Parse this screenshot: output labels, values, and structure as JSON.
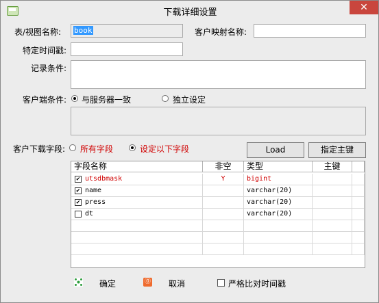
{
  "window": {
    "title": "下载详细设置",
    "close_glyph": "✕"
  },
  "form": {
    "table_view_label": "表/视图名称:",
    "table_view_value": "book",
    "client_map_label": "客户映射名称:",
    "client_map_value": "",
    "specific_time_label": "特定时间戳:",
    "specific_time_value": "",
    "record_cond_label": "记录条件:",
    "record_cond_value": "",
    "client_cond_label": "客户端条件:",
    "client_cond_options": [
      "与服务器一致",
      "独立设定"
    ],
    "client_cond_selected": "与服务器一致",
    "client_cond_value": "",
    "client_download_label": "客户下载字段:",
    "download_options": [
      "所有字段",
      "设定以下字段"
    ],
    "download_selected": "设定以下字段",
    "load_button": "Load",
    "pk_button": "指定主键"
  },
  "grid": {
    "columns": [
      "字段名称",
      "非空",
      "类型",
      "主键"
    ],
    "rows": [
      {
        "checked": true,
        "name": "utsdbmask",
        "notnull": "Y",
        "type": "bigint",
        "pk": "",
        "highlight": true
      },
      {
        "checked": true,
        "name": "name",
        "notnull": "",
        "type": "varchar(20)",
        "pk": "",
        "highlight": false
      },
      {
        "checked": true,
        "name": "press",
        "notnull": "",
        "type": "varchar(20)",
        "pk": "",
        "highlight": false
      },
      {
        "checked": false,
        "name": "dt",
        "notnull": "",
        "type": "varchar(20)",
        "pk": "",
        "highlight": false
      }
    ]
  },
  "footer": {
    "ok_label": "确定",
    "cancel_label": "取消",
    "strict_compare_label": "严格比对时间戳",
    "strict_compare_checked": false
  },
  "colors": {
    "accent_red": "#d00000",
    "close_red": "#c9463d",
    "selection_blue": "#3399ff"
  },
  "icons": {
    "app": "app-window-icon",
    "ok": "confirm-icon",
    "cancel": "cancel-icon"
  }
}
